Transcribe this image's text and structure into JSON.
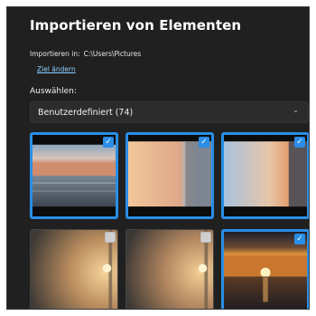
{
  "dialog": {
    "title": "Importieren von Elementen",
    "import_path_label": "Importieren in:",
    "import_path_value": "C:\\Users\\Pictures",
    "change_target_link": "Ziel ändern",
    "select_label": "Auswählen:",
    "select_dropdown_value": "Benutzerdefiniert (74)",
    "dropdown_icon": "chevron-down-icon",
    "accent_color": "#2a8ee6"
  },
  "thumbnails": [
    {
      "scene": "seascape-dusk",
      "selected": true
    },
    {
      "scene": "rotated-sunset-sea",
      "selected": true
    },
    {
      "scene": "rotated-sunset-sea-2",
      "selected": true
    },
    {
      "scene": "rotated-golden-sun",
      "selected": false
    },
    {
      "scene": "rotated-golden-sun-2",
      "selected": false
    },
    {
      "scene": "sunset-over-sea",
      "selected": true
    }
  ]
}
